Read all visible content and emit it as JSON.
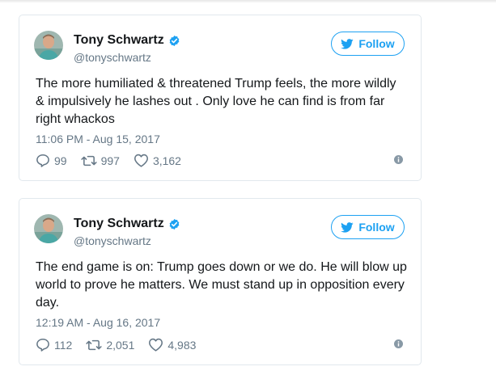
{
  "colors": {
    "accent": "#1da1f2",
    "text": "#14171a",
    "muted": "#657786",
    "border": "#e1e8ed"
  },
  "tweets": [
    {
      "author_name": "Tony Schwartz",
      "handle": "@tonyschwartz",
      "follow_label": "Follow",
      "text": "The more humiliated & threatened Trump feels, the more wildly & impulsively he lashes out . Only love he can find is from far right whackos",
      "timestamp": "11:06 PM - Aug 15, 2017",
      "replies": "99",
      "retweets": "997",
      "likes": "3,162",
      "icons": [
        "avatar",
        "verified-badge-icon",
        "bird-icon",
        "reply-icon",
        "retweet-icon",
        "like-icon",
        "info-icon"
      ]
    },
    {
      "author_name": "Tony Schwartz",
      "handle": "@tonyschwartz",
      "follow_label": "Follow",
      "text": "The end game is on: Trump goes down or we do. He will blow up world to prove he matters. We must stand up in opposition every day.",
      "timestamp": "12:19 AM - Aug 16, 2017",
      "replies": "112",
      "retweets": "2,051",
      "likes": "4,983",
      "icons": [
        "avatar",
        "verified-badge-icon",
        "bird-icon",
        "reply-icon",
        "retweet-icon",
        "like-icon",
        "info-icon"
      ]
    }
  ]
}
